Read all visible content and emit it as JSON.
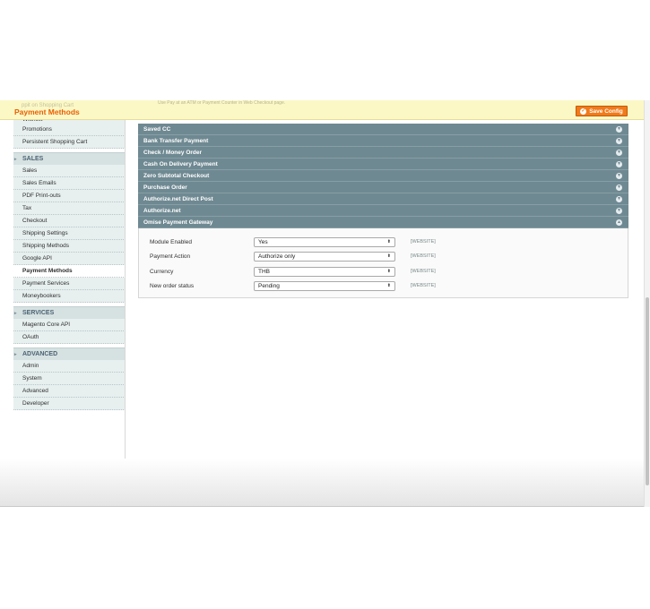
{
  "header": {
    "title": "Payment Methods",
    "faded_text": "Use Pay at an ATM or Payment Counter in Web Checkout page.",
    "faded_left": "ppit on Shopping Cart",
    "save_label": "Save Config"
  },
  "sidebar": {
    "cut_item": "Wishlist",
    "items_top": [
      "Promotions",
      "Persistent Shopping Cart"
    ],
    "sections": [
      {
        "label": "SALES",
        "items": [
          "Sales",
          "Sales Emails",
          "PDF Print-outs",
          "Tax",
          "Checkout",
          "Shipping Settings",
          "Shipping Methods",
          "Google API",
          "Payment Methods",
          "Payment Services",
          "Moneybookers"
        ]
      },
      {
        "label": "SERVICES",
        "items": [
          "Magento Core API",
          "OAuth"
        ]
      },
      {
        "label": "ADVANCED",
        "items": [
          "Admin",
          "System",
          "Advanced",
          "Developer"
        ]
      }
    ],
    "active": "Payment Methods"
  },
  "sections": [
    "Saved CC",
    "Bank Transfer Payment",
    "Check / Money Order",
    "Cash On Delivery Payment",
    "Zero Subtotal Checkout",
    "Purchase Order",
    "Authorize.net Direct Post",
    "Authorize.net",
    "Omise Payment Gateway"
  ],
  "omise": {
    "fields": [
      {
        "label": "Module Enabled",
        "value": "Yes",
        "scope": "[WEBSITE]"
      },
      {
        "label": "Payment Action",
        "value": "Authorize only",
        "scope": "[WEBSITE]"
      },
      {
        "label": "Currency",
        "value": "THB",
        "scope": "[WEBSITE]"
      },
      {
        "label": "New order status",
        "value": "Pending",
        "scope": "[WEBSITE]"
      }
    ]
  },
  "colors": {
    "title": "#eb5e00",
    "save_button": "#ef7b1d",
    "section_header": "#6f8992",
    "sticky_bg": "#fbf8c6"
  }
}
